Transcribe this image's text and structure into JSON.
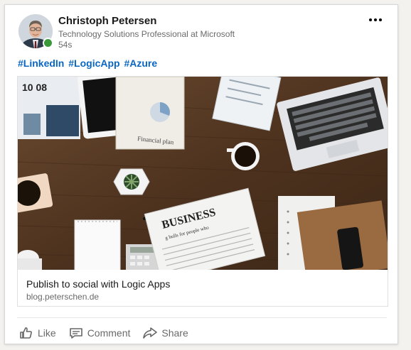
{
  "post": {
    "author": {
      "name": "Christoph Petersen",
      "title": "Technology Solutions Professional at Microsoft",
      "time": "54s",
      "presence_color": "#3a9a3a"
    },
    "hashtags": [
      "#LinkedIn",
      "#LogicApp",
      "#Azure"
    ],
    "link_preview": {
      "title": "Publish to social with Logic Apps",
      "domain": "blog.peterschen.de",
      "image": {
        "newspaper_headline": "BUSINESS",
        "newspaper_subline": "g bulls for people who",
        "document_label": "Financial plan",
        "top_left_numbers": "10  08"
      }
    },
    "actions": [
      {
        "label": "Like",
        "icon": "thumbs-up-icon"
      },
      {
        "label": "Comment",
        "icon": "comment-icon"
      },
      {
        "label": "Share",
        "icon": "share-icon"
      }
    ],
    "colors": {
      "accent": "#0a66c2",
      "wood": "#5b3d27"
    }
  }
}
